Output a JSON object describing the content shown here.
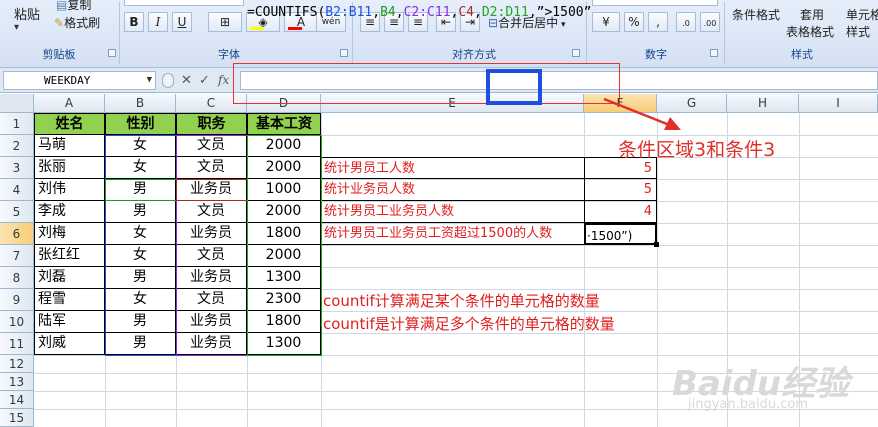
{
  "ribbon": {
    "clipboard": {
      "paste": "粘贴",
      "copy": "复制",
      "format_painter": "格式刷",
      "label": "剪贴板"
    },
    "font": {
      "label": "字体",
      "bold": "B",
      "italic": "I",
      "underline": "U",
      "font_color": "A",
      "wen": "wén"
    },
    "alignment": {
      "label": "对齐方式",
      "merge": "合并后居中"
    },
    "number": {
      "label": "数字",
      "percent": "%",
      "comma": ","
    },
    "styles": {
      "label": "样式",
      "cond_format": "条件格式",
      "table_format_1": "套用",
      "table_format_2": "表格格式",
      "cell_style_1": "单元格",
      "cell_style_2": "样式"
    }
  },
  "formula_bar": {
    "name_box": "WEEKDAY",
    "fx": "fx",
    "cancel": "✕",
    "enter": "✓",
    "formula": {
      "prefix": "=COUNTIFS(",
      "r1": "B2:B11",
      "c1": "B4",
      "r2": "C2:C11",
      "c2": "C4",
      "r3": "D2:D11",
      "tail": ",”>1500”"
    }
  },
  "columns": [
    "A",
    "B",
    "C",
    "D",
    "E",
    "F",
    "G",
    "H",
    "I"
  ],
  "rows": [
    "1",
    "2",
    "3",
    "4",
    "5",
    "6",
    "7",
    "8",
    "9",
    "10",
    "11",
    "12",
    "13",
    "14",
    "15"
  ],
  "table": {
    "headers": [
      "姓名",
      "性别",
      "职务",
      "基本工资"
    ],
    "rows": [
      [
        "马萌",
        "女",
        "文员",
        "2000"
      ],
      [
        "张丽",
        "女",
        "文员",
        "2000"
      ],
      [
        "刘伟",
        "男",
        "业务员",
        "1000"
      ],
      [
        "李成",
        "男",
        "文员",
        "2000"
      ],
      [
        "刘梅",
        "女",
        "业务员",
        "1800"
      ],
      [
        "张红红",
        "女",
        "文员",
        "2000"
      ],
      [
        "刘磊",
        "男",
        "业务员",
        "1300"
      ],
      [
        "程雪",
        "女",
        "文员",
        "2300"
      ],
      [
        "陆军",
        "男",
        "业务员",
        "1800"
      ],
      [
        "刘威",
        "男",
        "业务员",
        "1300"
      ]
    ]
  },
  "stats": [
    {
      "label": "统计男员工人数",
      "value": "5"
    },
    {
      "label": "统计业务员人数",
      "value": "5"
    },
    {
      "label": "统计男员工业务员人数",
      "value": "4"
    },
    {
      "label": "统计男员工业务员工资超过1500的人数",
      "value": "·1500”)"
    }
  ],
  "notes": {
    "countif": "countif计算满足某个条件的单元格的数量",
    "countifs": "countif是计算满足多个条件的单元格的数量"
  },
  "annotation": "条件区域3和条件3",
  "watermark": {
    "brand": "Baidu经验",
    "url": "jingyan.baidu.com"
  },
  "colors": {
    "header_green": "#92d050",
    "annotation_red": "#e0302a",
    "highlight_blue": "#1f4fe0"
  }
}
